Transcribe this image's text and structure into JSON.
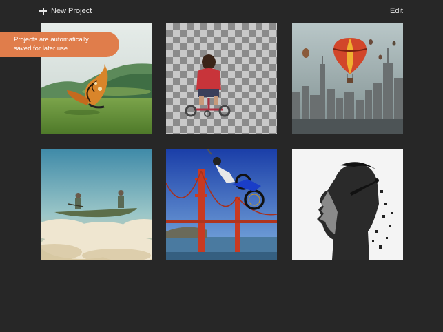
{
  "toolbar": {
    "new_project_label": "New Project",
    "new_project_icon": "plus-icon",
    "edit_label": "Edit"
  },
  "tooltip": {
    "line1": "Projects are automatically",
    "line2": "saved for later use."
  },
  "colors": {
    "background": "#272727",
    "tooltip_accent": "#e07d4b",
    "text": "#e6e6e6"
  },
  "projects": [
    {
      "subject": "butterfly-landscape"
    },
    {
      "subject": "child-on-tricycle-transparent"
    },
    {
      "subject": "hot-air-balloon-city"
    },
    {
      "subject": "canoe-on-clouds"
    },
    {
      "subject": "motocross-over-bridge"
    },
    {
      "subject": "double-exposure-profile"
    }
  ]
}
